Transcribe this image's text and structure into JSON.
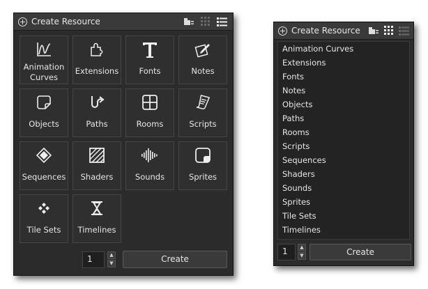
{
  "left": {
    "title": "Create Resource",
    "tiles": [
      {
        "label": "Animation Curves",
        "icon": "animation-curve-icon"
      },
      {
        "label": "Extensions",
        "icon": "puzzle-icon"
      },
      {
        "label": "Fonts",
        "icon": "font-t-icon"
      },
      {
        "label": "Notes",
        "icon": "note-pencil-icon"
      },
      {
        "label": "Objects",
        "icon": "object-square-icon"
      },
      {
        "label": "Paths",
        "icon": "path-arrow-icon"
      },
      {
        "label": "Rooms",
        "icon": "room-grid-icon"
      },
      {
        "label": "Scripts",
        "icon": "script-scroll-icon"
      },
      {
        "label": "Sequences",
        "icon": "sequence-diamond-icon"
      },
      {
        "label": "Shaders",
        "icon": "shader-hatch-icon"
      },
      {
        "label": "Sounds",
        "icon": "soundwave-icon"
      },
      {
        "label": "Sprites",
        "icon": "sprite-square-icon"
      },
      {
        "label": "Tile Sets",
        "icon": "tileset-diamonds-icon"
      },
      {
        "label": "Timelines",
        "icon": "hourglass-icon"
      }
    ],
    "quantity": "1",
    "create_label": "Create"
  },
  "right": {
    "title": "Create Resource",
    "items": [
      "Animation Curves",
      "Extensions",
      "Fonts",
      "Notes",
      "Objects",
      "Paths",
      "Rooms",
      "Scripts",
      "Sequences",
      "Shaders",
      "Sounds",
      "Sprites",
      "Tile Sets",
      "Timelines"
    ],
    "quantity": "1",
    "create_label": "Create"
  }
}
